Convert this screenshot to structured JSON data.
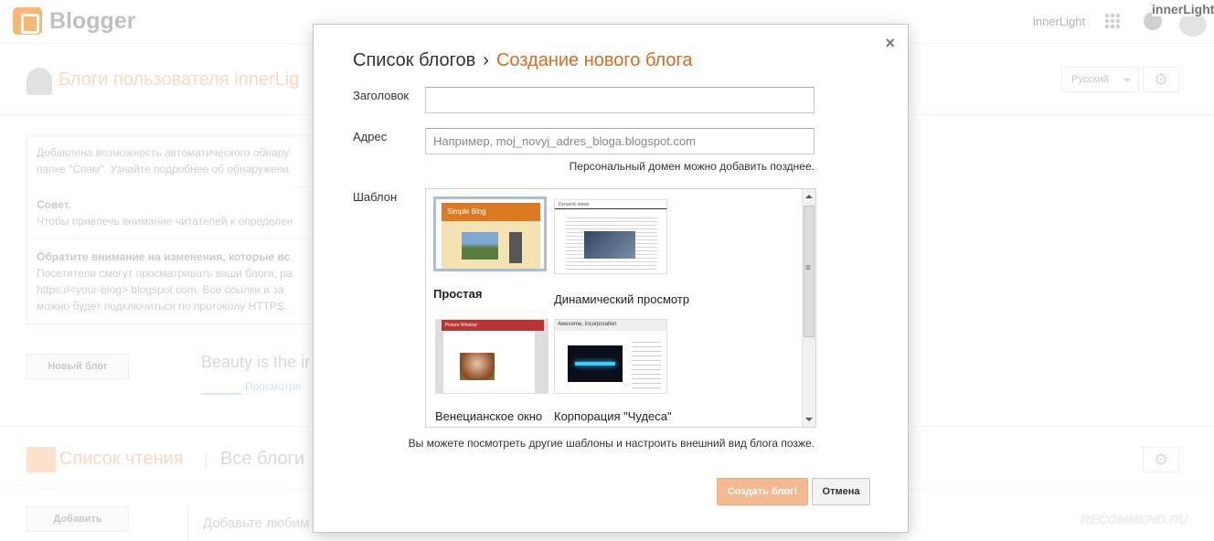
{
  "app": {
    "logo_text": "Blogger",
    "top_user": "innerLight",
    "top_name_overlay": "innerLight",
    "owner_title": "Блоги пользователя innerLig",
    "language": "Русский"
  },
  "notices": [
    {
      "title": "",
      "text": "Добавлена возможность автоматического обнару папке \"Спам\". Узнайте подробнее об обнаружени"
    },
    {
      "title": "Совет.",
      "text": "Чтобы привлечь внимание читателей к определен"
    },
    {
      "title": "Обратите внимание на изменения, которые вс",
      "text": "Посетители смогут просматривать ваши блоги, ра https://<your-blog>.blogspot.com. Все ссылки и за можно будет подключиться по протоколу HTTPS."
    }
  ],
  "new_blog_button": "Новый блог",
  "blog_item": {
    "title": "Beauty is the ir",
    "sub": "Просмотро"
  },
  "reading_list": {
    "title": "Список чтения",
    "separator": "|",
    "all": "Все блоги",
    "add_button": "Добавить",
    "add_hint": "Добавьте любим"
  },
  "watermark": "RECOMMEND.RU",
  "dialog": {
    "breadcrumb_root": "Список блогов",
    "breadcrumb_sep": "›",
    "breadcrumb_current": "Создание нового блога",
    "title_label": "Заголовок",
    "title_value": "",
    "address_label": "Адрес",
    "address_placeholder": "Например, moj_novyj_adres_bloga.blogspot.com",
    "address_hint": "Персональный домен можно добавить позднее.",
    "template_label": "Шаблон",
    "templates": [
      {
        "name": "Простая",
        "thumb_title": "Simple Blog",
        "selected": true
      },
      {
        "name": "Динамический просмотр",
        "thumb_title": "Dynamic views",
        "selected": false
      },
      {
        "name": "Венецианское окно",
        "thumb_title": "Picture Window",
        "selected": false
      },
      {
        "name": "Корпорация \"Чудеса\"",
        "thumb_title": "Awesome, Incorporation",
        "selected": false
      }
    ],
    "templates_hint": "Вы можете посмотреть другие шаблоны и настроить внешний вид блога позже.",
    "create_button": "Создать блог!",
    "cancel_button": "Отмена",
    "close_icon": "×"
  },
  "colors": {
    "brand": "#f57d00",
    "breadcrumb_current": "#dd6b1d",
    "create_button_disabled": "#f4b893"
  }
}
